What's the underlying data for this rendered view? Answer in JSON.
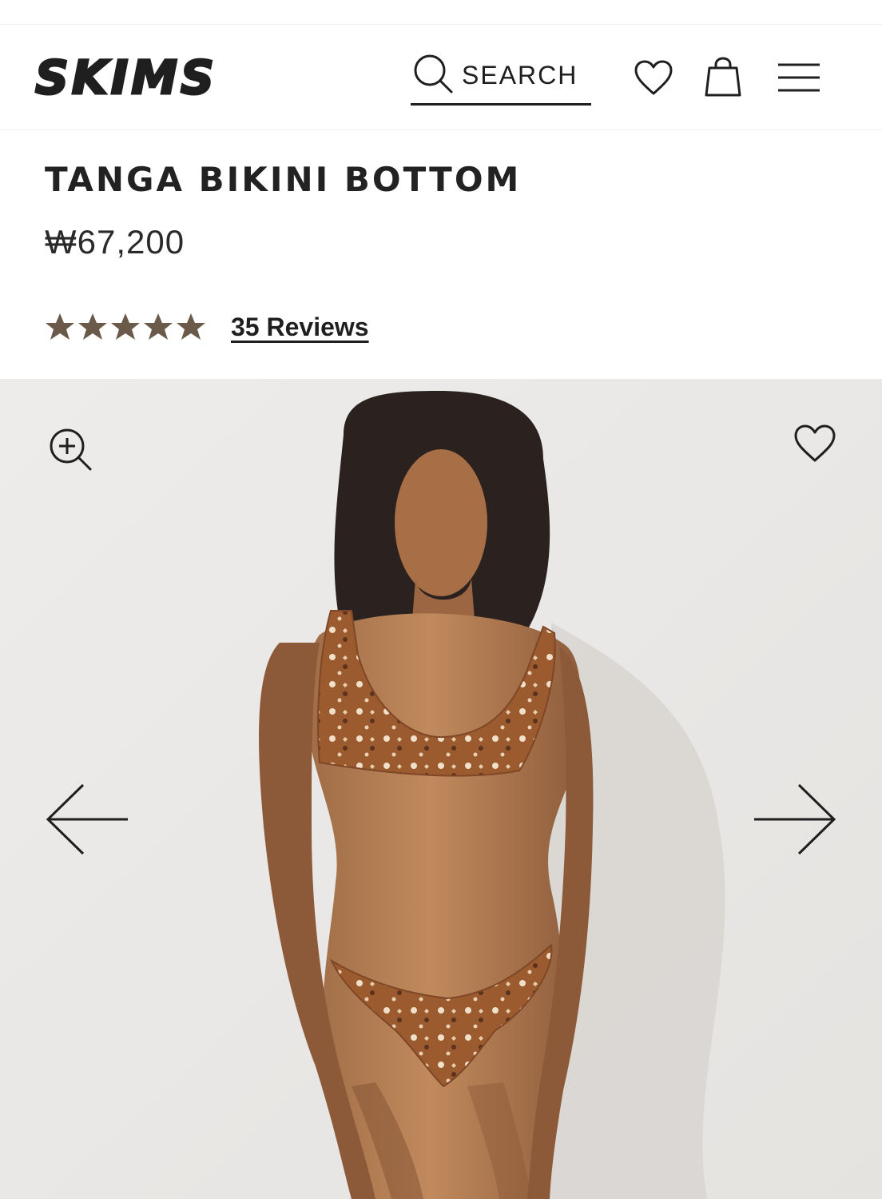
{
  "header": {
    "logo_text": "SKIMS",
    "search_label": "SEARCH",
    "icons": {
      "search": "search-icon",
      "wishlist": "heart-icon",
      "cart": "shopping-bag-icon",
      "menu": "hamburger-menu-icon"
    }
  },
  "product": {
    "title": "TANGA BIKINI BOTTOM",
    "price": "₩67,200",
    "rating": {
      "stars": 5,
      "max": 5,
      "color": "#6b5a4a"
    },
    "reviews_label": "35 Reviews"
  },
  "gallery": {
    "icons": {
      "zoom": "zoom-in-icon",
      "favorite": "heart-icon",
      "previous": "arrow-left-icon",
      "next": "arrow-right-icon"
    }
  },
  "colors": {
    "text": "#1f1f1f",
    "star": "#6b5a4a",
    "gallery_background": "#ebe9e6",
    "swimsuit": "#9b5b2f"
  }
}
